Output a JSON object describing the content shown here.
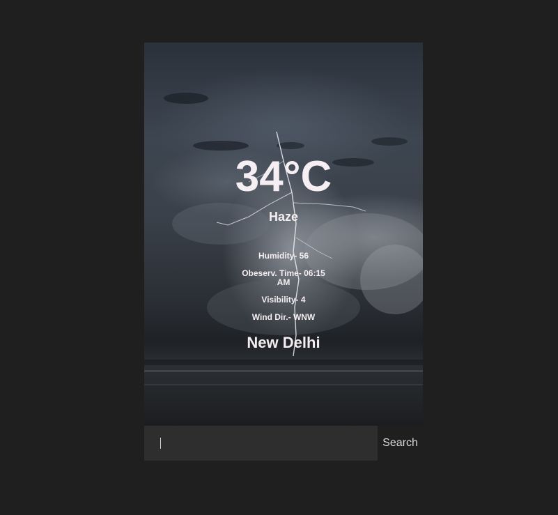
{
  "weather": {
    "temperature": "34°C",
    "condition": "Haze",
    "details": [
      "Humidity- 56",
      "Obeserv. Time- 06:15 AM",
      "Visibility- 4",
      "Wind Dir.- WNW"
    ],
    "city": "New Delhi"
  },
  "search": {
    "placeholder": "",
    "value": "",
    "button_label": "Search"
  },
  "colors": {
    "page_background": "#1f1f1f",
    "text": "#f4eef0",
    "input_background": "#2e2e2e"
  }
}
